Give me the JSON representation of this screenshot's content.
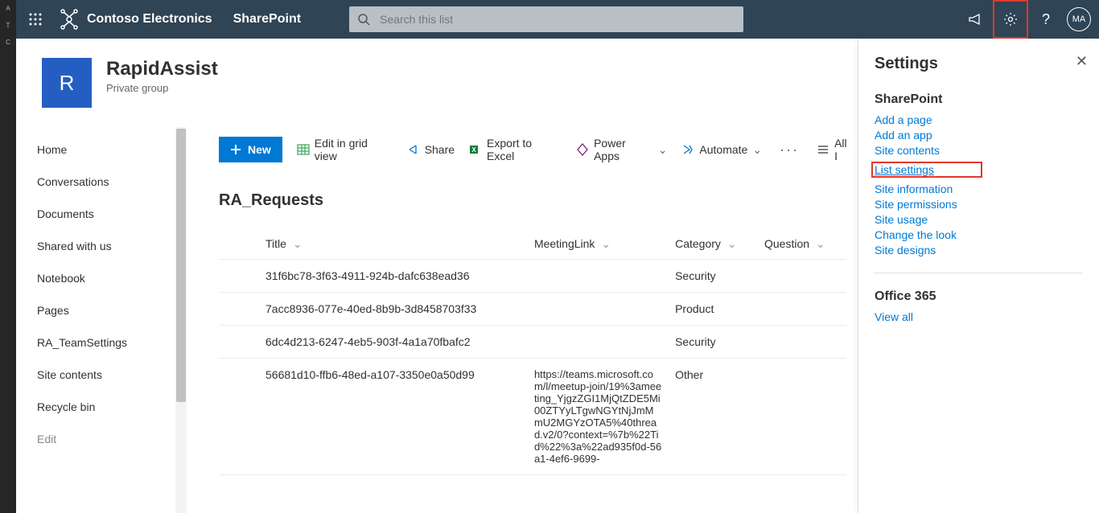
{
  "brand": "Contoso Electronics",
  "app": "SharePoint",
  "search": {
    "placeholder": "Search this list"
  },
  "avatar": "MA",
  "site": {
    "logo_letter": "R",
    "title": "RapidAssist",
    "subtitle": "Private group"
  },
  "nav": {
    "items": [
      "Home",
      "Conversations",
      "Documents",
      "Shared with us",
      "Notebook",
      "Pages",
      "RA_TeamSettings",
      "Site contents",
      "Recycle bin"
    ],
    "edit": "Edit"
  },
  "cmd": {
    "new": "New",
    "edit_grid": "Edit in grid view",
    "share": "Share",
    "export": "Export to Excel",
    "powerapps": "Power Apps",
    "automate": "Automate",
    "all_items": "All I"
  },
  "list": {
    "title": "RA_Requests",
    "columns": [
      "Title",
      "MeetingLink",
      "Category",
      "Question"
    ],
    "rows": [
      {
        "title": "31f6bc78-3f63-4911-924b-dafc638ead36",
        "link": "",
        "category": "Security",
        "question": ""
      },
      {
        "title": "7acc8936-077e-40ed-8b9b-3d8458703f33",
        "link": "",
        "category": "Product",
        "question": ""
      },
      {
        "title": "6dc4d213-6247-4eb5-903f-4a1a70fbafc2",
        "link": "",
        "category": "Security",
        "question": ""
      },
      {
        "title": "56681d10-ffb6-48ed-a107-3350e0a50d99",
        "link": "https://teams.microsoft.com/l/meetup-join/19%3ameeting_YjgzZGI1MjQtZDE5Mi00ZTYyLTgwNGYtNjJmMmU2MGYzOTA5%40thread.v2/0?context=%7b%22Tid%22%3a%22ad935f0d-56a1-4ef6-9699-",
        "category": "Other",
        "question": ""
      }
    ]
  },
  "panel": {
    "title": "Settings",
    "sp_heading": "SharePoint",
    "links": [
      "Add a page",
      "Add an app",
      "Site contents",
      "List settings",
      "Site information",
      "Site permissions",
      "Site usage",
      "Change the look",
      "Site designs"
    ],
    "highlight_index": 3,
    "o365_heading": "Office 365",
    "view_all": "View all"
  }
}
